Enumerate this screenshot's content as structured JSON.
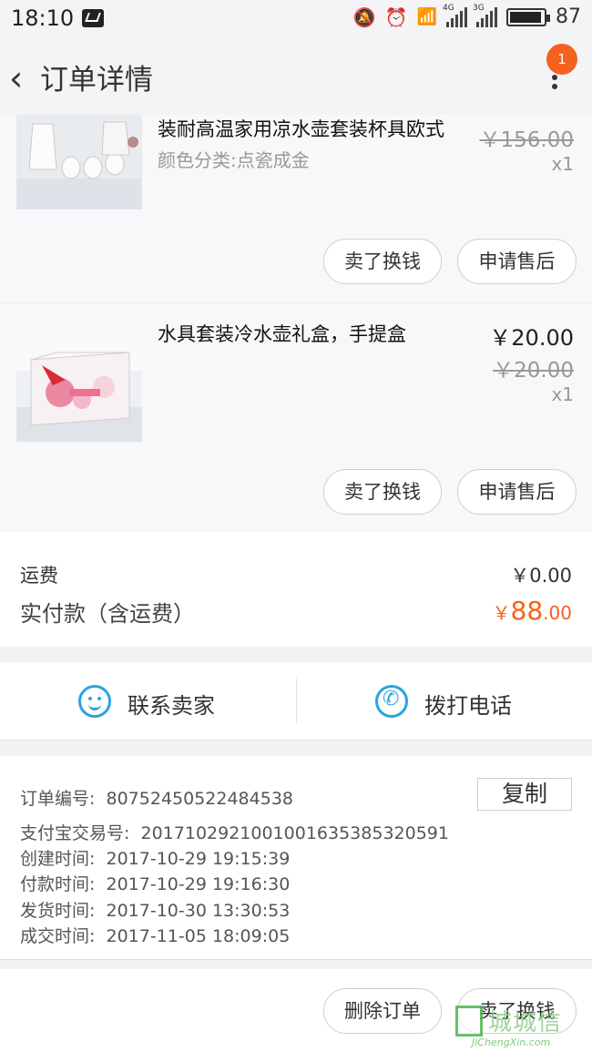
{
  "status": {
    "time": "18:10",
    "battery": "87",
    "net1": "4G",
    "net2": "3G"
  },
  "nav": {
    "back_icon": "chevron-left-icon",
    "title": "订单详情",
    "badge": "1"
  },
  "items": [
    {
      "name": "装耐高温家用凉水壶套装杯具欧式",
      "sku": "颜色分类:点瓷成金",
      "orig_price": "￥156.00",
      "qty": "x1",
      "btn_sell": "卖了换钱",
      "btn_service": "申请售后"
    },
    {
      "name": "水具套装冷水壶礼盒，手提盒",
      "price": "￥20.00",
      "orig_price": "￥20.00",
      "qty": "x1",
      "btn_sell": "卖了换钱",
      "btn_service": "申请售后"
    }
  ],
  "fee": {
    "shipping_label": "运费",
    "shipping_value": "￥0.00",
    "paid_label": "实付款（含运费）",
    "paid_currency": "￥",
    "paid_int": "88",
    "paid_dec": ".00"
  },
  "contact": {
    "seller": "联系卖家",
    "call": "拨打电话"
  },
  "info": {
    "order_no_label": "订单编号:",
    "order_no": "80752450522484538",
    "copy": "复制",
    "alipay_label": "支付宝交易号:",
    "alipay_no": "2017102921001001635385320591",
    "created_label": "创建时间:",
    "created": "2017-10-29 19:15:39",
    "paid_label": "付款时间:",
    "paid": "2017-10-29 19:16:30",
    "shipped_label": "发货时间:",
    "shipped": "2017-10-30 13:30:53",
    "done_label": "成交时间:",
    "done": "2017-11-05 18:09:05"
  },
  "bottom": {
    "delete": "删除订单",
    "sell": "卖了换钱"
  },
  "watermark": {
    "cn": "城城信",
    "en": "JiChengXin.com"
  },
  "colors": {
    "accent": "#f5611f",
    "icon_blue": "#2aa2e0"
  }
}
